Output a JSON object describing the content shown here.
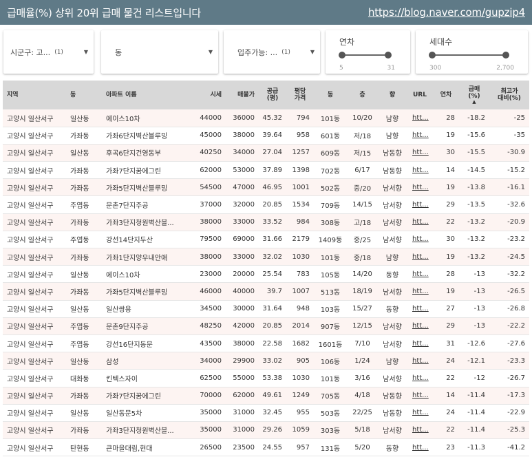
{
  "header": {
    "title": "급매율(%) 상위 20위 급매 물건 리스트입니다",
    "link": "https://blog.naver.com/gupzip4"
  },
  "filters": {
    "district": {
      "label": "시군구: 고...",
      "count": "(1)"
    },
    "dong": {
      "label": "동"
    },
    "move_in": {
      "label": "입주가능: ...",
      "count": "(1)"
    },
    "age": {
      "label": "연차",
      "min": "5",
      "max": "31",
      "low_frac": 0.0,
      "high_frac": 1.0
    },
    "households": {
      "label": "세대수",
      "min": "300",
      "max": "2,700",
      "low_frac": 0.0,
      "high_frac": 1.0
    }
  },
  "table": {
    "columns": [
      "지역",
      "동",
      "아파트 이름",
      "시세",
      "매물가",
      "공급\n(평)",
      "평당\n가격",
      "동",
      "층",
      "향",
      "URL",
      "연차",
      "급매\n(%)",
      "최고가\n대비(%)"
    ],
    "rows": [
      [
        "고양시 일산서구",
        "일산동",
        "에이스10차",
        "44000",
        "36000",
        "45.32",
        "794",
        "101동",
        "10/20",
        "남향",
        "htt...",
        "28",
        "-18.2",
        "-25"
      ],
      [
        "고양시 일산서구",
        "가좌동",
        "가좌6단지벽산블루밍",
        "45000",
        "38000",
        "39.64",
        "958",
        "601동",
        "저/18",
        "남향",
        "htt...",
        "19",
        "-15.6",
        "-35"
      ],
      [
        "고양시 일산서구",
        "일산동",
        "후곡6단지건영동부",
        "40250",
        "34000",
        "27.04",
        "1257",
        "609동",
        "저/15",
        "남동향",
        "htt...",
        "30",
        "-15.5",
        "-30.9"
      ],
      [
        "고양시 일산서구",
        "가좌동",
        "가좌7단지꿈에그린",
        "62000",
        "53000",
        "37.89",
        "1398",
        "702동",
        "6/17",
        "남동향",
        "htt...",
        "14",
        "-14.5",
        "-15.2"
      ],
      [
        "고양시 일산서구",
        "가좌동",
        "가좌5단지벽산블루밍",
        "54500",
        "47000",
        "46.95",
        "1001",
        "502동",
        "중/20",
        "남서향",
        "htt...",
        "19",
        "-13.8",
        "-16.1"
      ],
      [
        "고양시 일산서구",
        "주엽동",
        "문촌7단지주공",
        "37000",
        "32000",
        "20.85",
        "1534",
        "709동",
        "14/15",
        "남서향",
        "htt...",
        "29",
        "-13.5",
        "-32.6"
      ],
      [
        "고양시 일산서구",
        "가좌동",
        "가좌3단지청원벽산블...",
        "38000",
        "33000",
        "33.52",
        "984",
        "308동",
        "고/18",
        "남서향",
        "htt...",
        "22",
        "-13.2",
        "-20.9"
      ],
      [
        "고양시 일산서구",
        "주엽동",
        "강선14단지두산",
        "79500",
        "69000",
        "31.66",
        "2179",
        "1409동",
        "중/25",
        "남서향",
        "htt...",
        "30",
        "-13.2",
        "-23.2"
      ],
      [
        "고양시 일산서구",
        "가좌동",
        "가좌1단지양우내안애",
        "38000",
        "33000",
        "32.02",
        "1030",
        "101동",
        "중/18",
        "남향",
        "htt...",
        "19",
        "-13.2",
        "-24.5"
      ],
      [
        "고양시 일산서구",
        "일산동",
        "에이스10차",
        "23000",
        "20000",
        "25.54",
        "783",
        "105동",
        "14/20",
        "동향",
        "htt...",
        "28",
        "-13",
        "-32.2"
      ],
      [
        "고양시 일산서구",
        "가좌동",
        "가좌5단지벽산블루밍",
        "46000",
        "40000",
        "39.7",
        "1007",
        "513동",
        "18/19",
        "남서향",
        "htt...",
        "19",
        "-13",
        "-26.5"
      ],
      [
        "고양시 일산서구",
        "일산동",
        "일산쌍용",
        "34500",
        "30000",
        "31.64",
        "948",
        "103동",
        "15/27",
        "동향",
        "htt...",
        "27",
        "-13",
        "-26.8"
      ],
      [
        "고양시 일산서구",
        "주엽동",
        "문촌9단지주공",
        "48250",
        "42000",
        "20.85",
        "2014",
        "907동",
        "12/15",
        "남서향",
        "htt...",
        "29",
        "-13",
        "-22.2"
      ],
      [
        "고양시 일산서구",
        "주엽동",
        "강선16단지동문",
        "43500",
        "38000",
        "22.58",
        "1682",
        "1601동",
        "7/10",
        "남서향",
        "htt...",
        "31",
        "-12.6",
        "-27.6"
      ],
      [
        "고양시 일산서구",
        "일산동",
        "삼성",
        "34000",
        "29900",
        "33.02",
        "905",
        "106동",
        "1/24",
        "남향",
        "htt...",
        "24",
        "-12.1",
        "-23.3"
      ],
      [
        "고양시 일산서구",
        "대화동",
        "킨텍스자이",
        "62500",
        "55000",
        "53.38",
        "1030",
        "101동",
        "3/16",
        "남서향",
        "htt...",
        "22",
        "-12",
        "-26.7"
      ],
      [
        "고양시 일산서구",
        "가좌동",
        "가좌7단지꿈에그린",
        "70000",
        "62000",
        "49.61",
        "1249",
        "705동",
        "4/18",
        "남동향",
        "htt...",
        "14",
        "-11.4",
        "-17.3"
      ],
      [
        "고양시 일산서구",
        "일산동",
        "일산동문5차",
        "35000",
        "31000",
        "32.45",
        "955",
        "503동",
        "22/25",
        "남동향",
        "htt...",
        "24",
        "-11.4",
        "-22.9"
      ],
      [
        "고양시 일산서구",
        "가좌동",
        "가좌3단지청원벽산블...",
        "35000",
        "31000",
        "29.26",
        "1059",
        "303동",
        "5/18",
        "남서향",
        "htt...",
        "22",
        "-11.4",
        "-25.3"
      ],
      [
        "고양시 일산서구",
        "탄현동",
        "큰마을대림,현대",
        "26500",
        "23500",
        "24.55",
        "957",
        "131동",
        "5/20",
        "동향",
        "htt...",
        "23",
        "-11.3",
        "-41.2"
      ]
    ]
  },
  "icons": {
    "caret": "caret-down-icon",
    "sort": "sort-asc-icon"
  },
  "colors": {
    "header_bg": "#5f7a87",
    "row_alt": "#fdf4f2",
    "table_head": "#d8d8d8"
  }
}
